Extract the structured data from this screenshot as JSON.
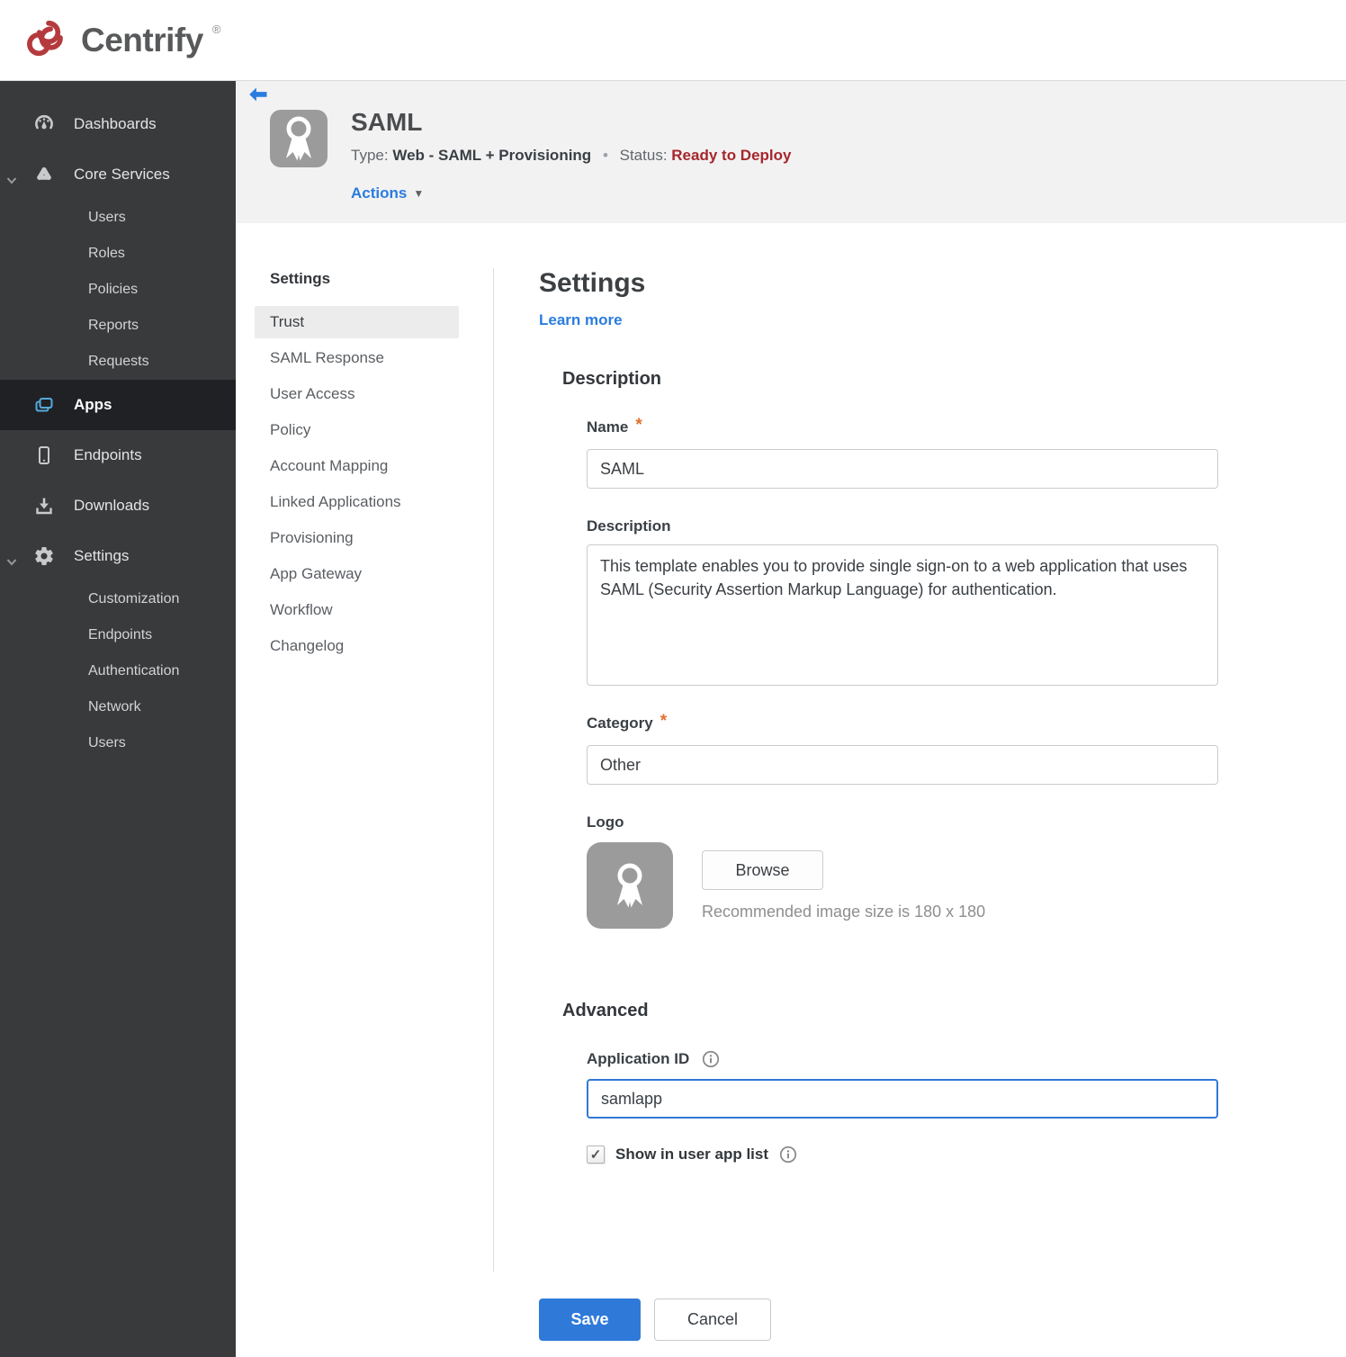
{
  "brand": {
    "name": "Centrify",
    "registered_mark": "®"
  },
  "icons": {
    "check": "✓",
    "caret_down": "▼",
    "separator_dot": "•",
    "required_marker": "*"
  },
  "colors": {
    "accent_blue": "#2a7cdf",
    "save_blue": "#2f7ad9",
    "status_red": "#a6262b",
    "asterisk_orange": "#e2702d",
    "apps_icon_blue": "#55a9dd",
    "sidebar_bg": "#393a3c",
    "sidebar_active_bg": "#202124",
    "header_band": "#f2f2f3",
    "logo_red": "#b43a3e"
  },
  "sidebar": {
    "items": [
      {
        "label": "Dashboards",
        "icon": "gauge-icon"
      },
      {
        "label": "Core Services",
        "icon": "core-services-icon",
        "expanded": true,
        "children": [
          {
            "label": "Users"
          },
          {
            "label": "Roles"
          },
          {
            "label": "Policies"
          },
          {
            "label": "Reports"
          },
          {
            "label": "Requests"
          }
        ]
      },
      {
        "label": "Apps",
        "icon": "apps-icon",
        "active": true
      },
      {
        "label": "Endpoints",
        "icon": "device-icon"
      },
      {
        "label": "Downloads",
        "icon": "download-icon"
      },
      {
        "label": "Settings",
        "icon": "gear-icon",
        "expanded": true,
        "children": [
          {
            "label": "Customization"
          },
          {
            "label": "Endpoints"
          },
          {
            "label": "Authentication"
          },
          {
            "label": "Network"
          },
          {
            "label": "Users"
          }
        ]
      }
    ]
  },
  "header": {
    "app_title": "SAML",
    "type_label": "Type:",
    "type_value": "Web - SAML + Provisioning",
    "status_label": "Status:",
    "status_value": "Ready to Deploy",
    "actions_label": "Actions"
  },
  "subnav": {
    "title": "Settings",
    "selected": "Trust",
    "items": [
      {
        "label": "Trust",
        "selected": true
      },
      {
        "label": "SAML Response"
      },
      {
        "label": "User Access"
      },
      {
        "label": "Policy"
      },
      {
        "label": "Account Mapping"
      },
      {
        "label": "Linked Applications"
      },
      {
        "label": "Provisioning"
      },
      {
        "label": "App Gateway"
      },
      {
        "label": "Workflow"
      },
      {
        "label": "Changelog"
      }
    ]
  },
  "main": {
    "title": "Settings",
    "learn_more_label": "Learn more",
    "description_section": {
      "heading": "Description",
      "name_label": "Name",
      "name_value": "SAML",
      "description_label": "Description",
      "description_value": "This template enables you to provide single sign-on to a web application that uses SAML (Security Assertion Markup Language) for authentication.",
      "category_label": "Category",
      "category_value": "Other",
      "logo_label": "Logo",
      "browse_button_label": "Browse",
      "logo_hint": "Recommended image size is 180 x 180"
    },
    "advanced_section": {
      "heading": "Advanced",
      "application_id_label": "Application ID",
      "application_id_value": "samlapp",
      "show_in_user_app_list_label": "Show in user app list",
      "checkbox_checked": true
    },
    "footer": {
      "save_label": "Save",
      "cancel_label": "Cancel"
    }
  }
}
